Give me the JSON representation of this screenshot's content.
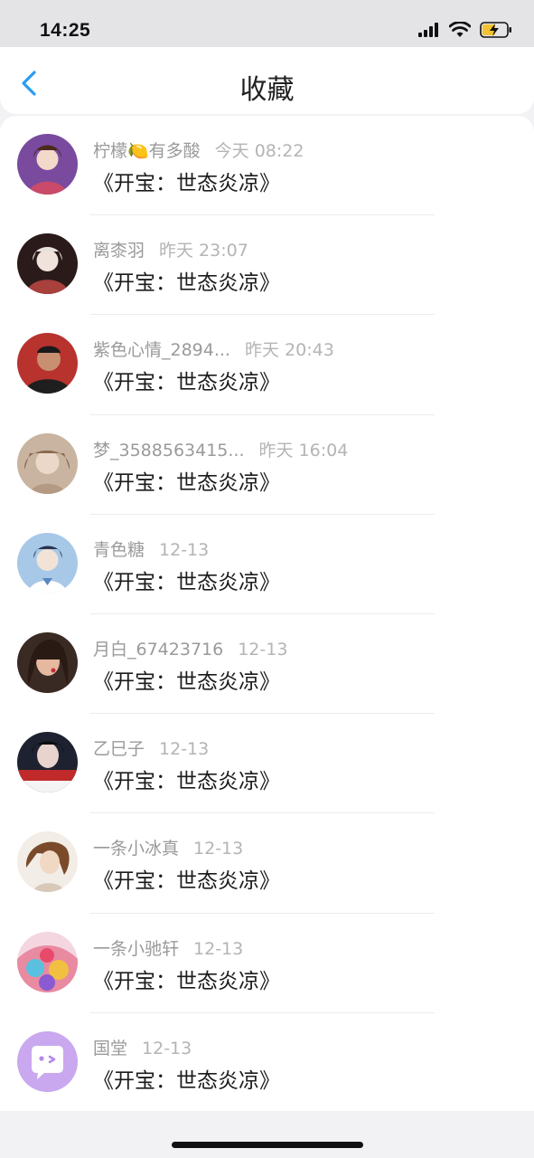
{
  "status_bar": {
    "time": "14:25"
  },
  "header": {
    "title": "收藏"
  },
  "items": [
    {
      "name": "柠檬🍋有多酸",
      "time": "今天 08:22",
      "content": "《开宝：世态炎凉》"
    },
    {
      "name": "离桼羽",
      "time": "昨天 23:07",
      "content": "《开宝：世态炎凉》"
    },
    {
      "name": "紫色心情_2894...",
      "time": "昨天 20:43",
      "content": "《开宝：世态炎凉》"
    },
    {
      "name": "梦_3588563415...",
      "time": "昨天 16:04",
      "content": "《开宝：世态炎凉》"
    },
    {
      "name": "青色糖",
      "time": "12-13",
      "content": "《开宝：世态炎凉》"
    },
    {
      "name": "月白_67423716",
      "time": "12-13",
      "content": "《开宝：世态炎凉》"
    },
    {
      "name": "乙巳子",
      "time": "12-13",
      "content": "《开宝：世态炎凉》"
    },
    {
      "name": "一条小冰真",
      "time": "12-13",
      "content": "《开宝：世态炎凉》"
    },
    {
      "name": "一条小驰轩",
      "time": "12-13",
      "content": "《开宝：世态炎凉》"
    },
    {
      "name": "国堂",
      "time": "12-13",
      "content": "《开宝：世态炎凉》"
    }
  ],
  "colors": {
    "accent": "#2a9df4",
    "avatar_bg": [
      "#7a4a9e",
      "#a8403c",
      "#3a3a3a",
      "#b49a82",
      "#5a86c0",
      "#8c4a3c",
      "#2a2e3a",
      "#d8c8b8",
      "#e88aa0",
      "#c9a8ef"
    ]
  }
}
